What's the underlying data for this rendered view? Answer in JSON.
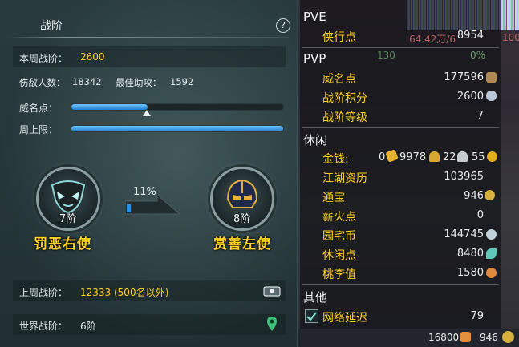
{
  "left": {
    "title": "战阶",
    "help": "?",
    "week_rank_label": "本周战阶：",
    "week_rank_value": "2600",
    "kills_label": "伤敌人数：",
    "kills_value": "18342",
    "assist_label": "最佳助攻：",
    "assist_value": "1592",
    "prestige_label": "威名点：",
    "prestige_progress": 0.36,
    "weekly_cap_label": "周上限：",
    "weekly_cap_progress": 1.0,
    "left_rank": {
      "level": "7阶",
      "name": "罚恶右使"
    },
    "right_rank": {
      "level": "8阶",
      "name": "赏善左使"
    },
    "progress_pct": "11%",
    "last_week_label": "上周战阶：",
    "last_week_value": "12333 (500名以外)",
    "world_label": "世界战阶：",
    "world_value": "6阶"
  },
  "right": {
    "strip_text": "64.42万/6",
    "strip_text2": "100",
    "strip_num": "130",
    "strip_pct": "0%",
    "sections": {
      "pve": "PVE",
      "pvp": "PVP",
      "leisure": "休闲",
      "other": "其他"
    },
    "pve_items": [
      {
        "label": "侠行点",
        "value": "8954"
      }
    ],
    "pvp_items": [
      {
        "label": "威名点",
        "value": "177596"
      },
      {
        "label": "战阶积分",
        "value": "2600"
      },
      {
        "label": "战阶等级",
        "value": "7"
      }
    ],
    "money": {
      "label": "金钱:",
      "v1": "0",
      "v2": "9978",
      "v3": "22",
      "v4": "55"
    },
    "leisure_items": [
      {
        "label": "江湖资历",
        "value": "103965"
      },
      {
        "label": "通宝",
        "value": "946"
      },
      {
        "label": "薪火点",
        "value": "0"
      },
      {
        "label": "园宅币",
        "value": "144745"
      },
      {
        "label": "休闲点",
        "value": "8480"
      },
      {
        "label": "桃李值",
        "value": "1580"
      }
    ],
    "other_items": [
      {
        "label": "网络延迟",
        "value": "79"
      }
    ],
    "bottom": {
      "left_value": "16800",
      "right_value": "946"
    }
  },
  "colors": {
    "gold": "#ffd21f",
    "bar": "#2e8ee0"
  }
}
